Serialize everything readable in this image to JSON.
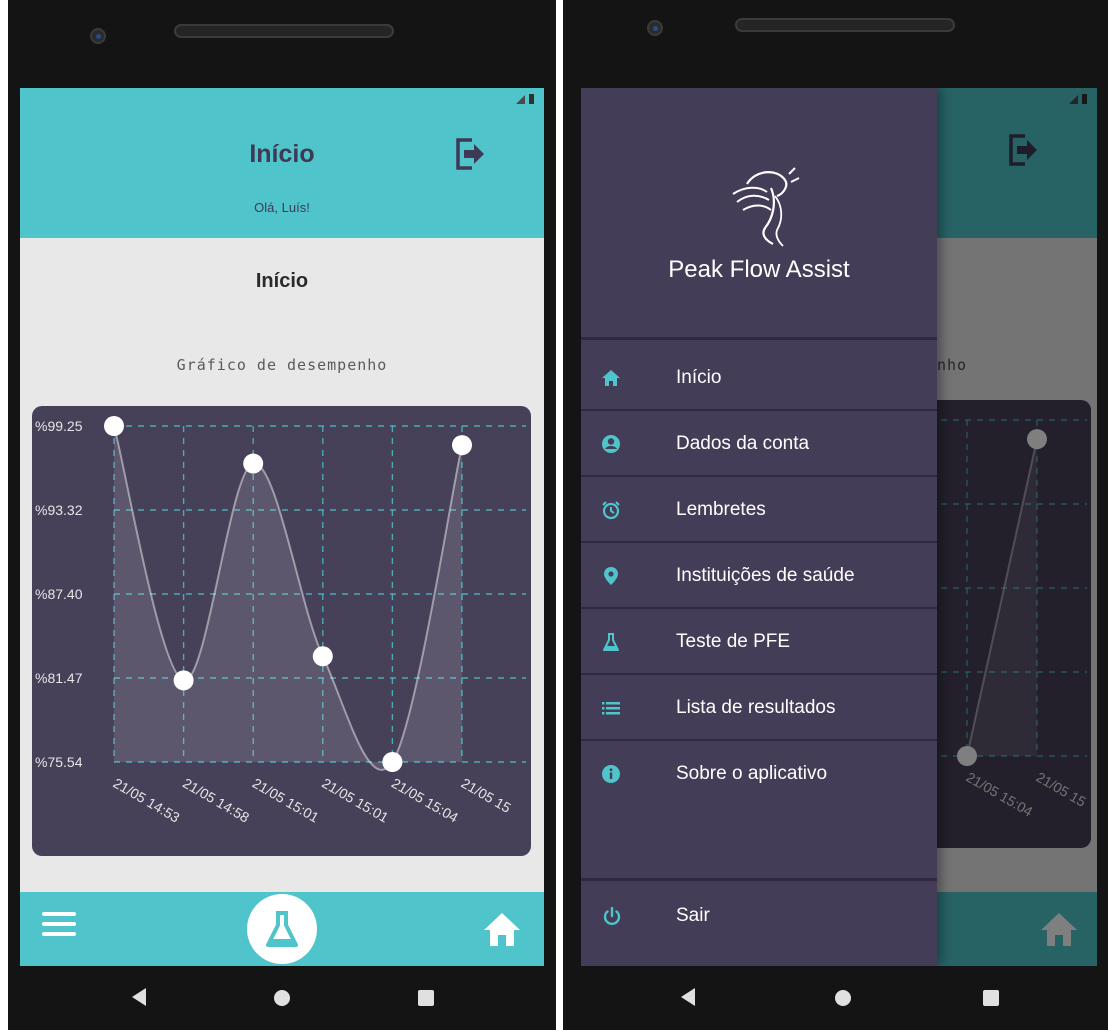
{
  "app": {
    "title": "Início",
    "greeting": "Olá, Luís!",
    "section_title": "Início",
    "chart_title": "Gráfico de desempenho"
  },
  "drawer": {
    "brand": "Peak Flow Assist",
    "items": [
      {
        "label": "Início",
        "icon": "home-icon"
      },
      {
        "label": "Dados da conta",
        "icon": "account-circle-icon"
      },
      {
        "label": "Lembretes",
        "icon": "alarm-clock-icon"
      },
      {
        "label": "Instituições de saúde",
        "icon": "location-pin-icon"
      },
      {
        "label": "Teste de PFE",
        "icon": "flask-icon"
      },
      {
        "label": "Lista de resultados",
        "icon": "list-icon"
      },
      {
        "label": "Sobre o aplicativo",
        "icon": "info-icon"
      }
    ],
    "logout_label": "Sair",
    "ghost_chart_title": "nho",
    "ghost_tick_labels": [
      "15:01",
      "21/05 15:04",
      "21/05 15"
    ]
  },
  "colors": {
    "accent": "#4fc4ca",
    "chart_bg": "#464058",
    "drawer_bg": "#433d57",
    "title_text": "#3e3a56"
  },
  "chart_data": {
    "type": "area",
    "title": "Gráfico de desempenho",
    "categories": [
      "21/05 14:53",
      "21/05 14:58",
      "21/05 15:01",
      "21/05 15:01",
      "21/05 15:04",
      "21/05 15"
    ],
    "series": [
      {
        "values": [
          99.25,
          81.3,
          96.6,
          83.0,
          75.54,
          97.9
        ]
      }
    ],
    "y_ticks": [
      "%99.25",
      "%93.32",
      "%87.40",
      "%81.47",
      "%75.54"
    ],
    "ylim": [
      75.54,
      99.25
    ],
    "grid": true,
    "drawer_preview": {
      "categories": [
        "21/05 15:04",
        "21/05 15"
      ],
      "values": [
        75.54,
        97.9
      ]
    }
  }
}
